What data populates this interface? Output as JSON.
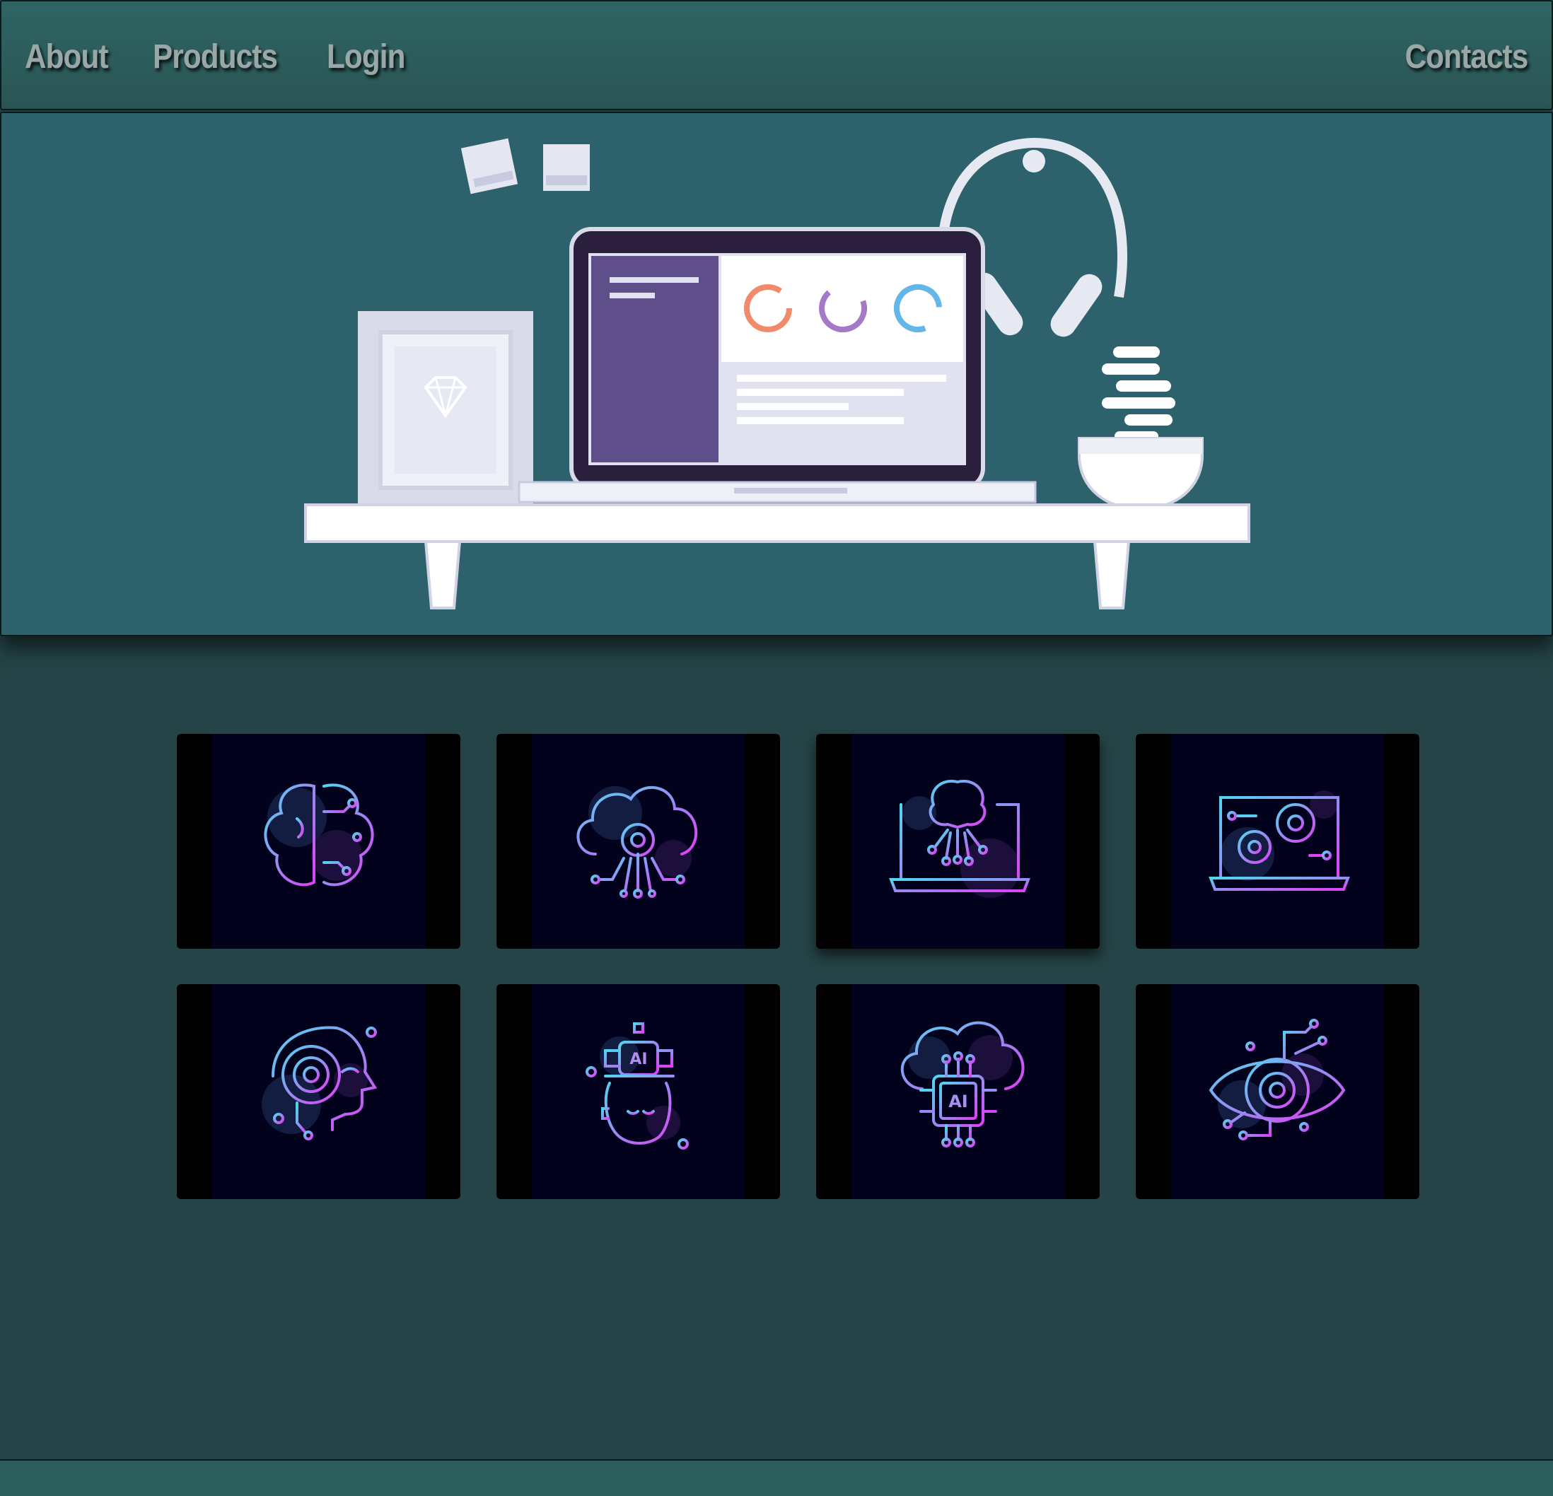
{
  "nav": {
    "about": "About",
    "products": "Products",
    "login": "Login",
    "contacts": "Contacts"
  },
  "colors": {
    "page_bg": "#254447",
    "nav_bg": "#2f6565",
    "hero_bg": "#2d616b",
    "card_bg": "#02021c",
    "icon_gradient_start": "#4fd8f0",
    "icon_gradient_end": "#e23ef5",
    "laptop_sidebar": "#5e4e8a"
  },
  "products": [
    {
      "icon": "ai-brain-circuit-icon"
    },
    {
      "icon": "cloud-gear-network-icon"
    },
    {
      "icon": "laptop-brain-icon"
    },
    {
      "icon": "laptop-gears-icon"
    },
    {
      "icon": "robot-head-icon"
    },
    {
      "icon": "human-head-ai-chip-icon"
    },
    {
      "icon": "cloud-ai-chip-icon"
    },
    {
      "icon": "eye-gear-icon"
    }
  ]
}
